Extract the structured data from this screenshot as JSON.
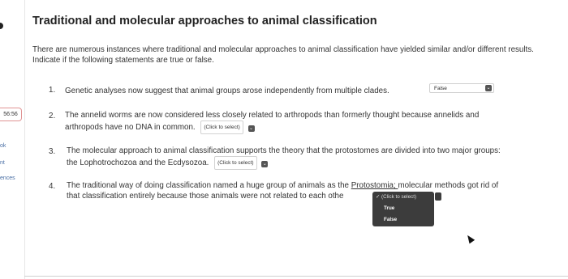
{
  "sidebar": {
    "timer": "56:56",
    "fragments": [
      "ok",
      "nt",
      "ences"
    ]
  },
  "question": {
    "title": "Traditional and molecular approaches to animal classification",
    "intro": "There are numerous instances where traditional and molecular approaches to animal classification have yielded similar and/or different results. Indicate if the following statements are true or false.",
    "items": [
      {
        "num": "1.",
        "text": "Genetic analyses now suggest that animal groups arose independently from multiple clades.",
        "answer": "False"
      },
      {
        "num": "2.",
        "text_line1": "The annelid worms are now considered less closely related to arthropods than formerly thought because annelids and",
        "text_line2": "arthropods have no DNA in common.",
        "answer": "(Click to select)"
      },
      {
        "num": "3.",
        "text_line1": "The molecular approach to animal classification supports the theory that the protostomes are divided into two major groups:",
        "text_line2": "the Lophotrochozoa and the Ecdysozoa.",
        "answer": "(Click to select)"
      },
      {
        "num": "4.",
        "text_line1a": "The traditional way of doing classification named a huge group of animals as the ",
        "text_line1b": "Protostomia; ",
        "text_line1c": "molecular methods got rid of",
        "text_line2": "that classification entirely because those animals were not related to each othe",
        "answer": "(Click to select)"
      }
    ]
  },
  "dropdown": {
    "header": "✓ (Click to select)",
    "options": [
      "True",
      "False"
    ]
  }
}
